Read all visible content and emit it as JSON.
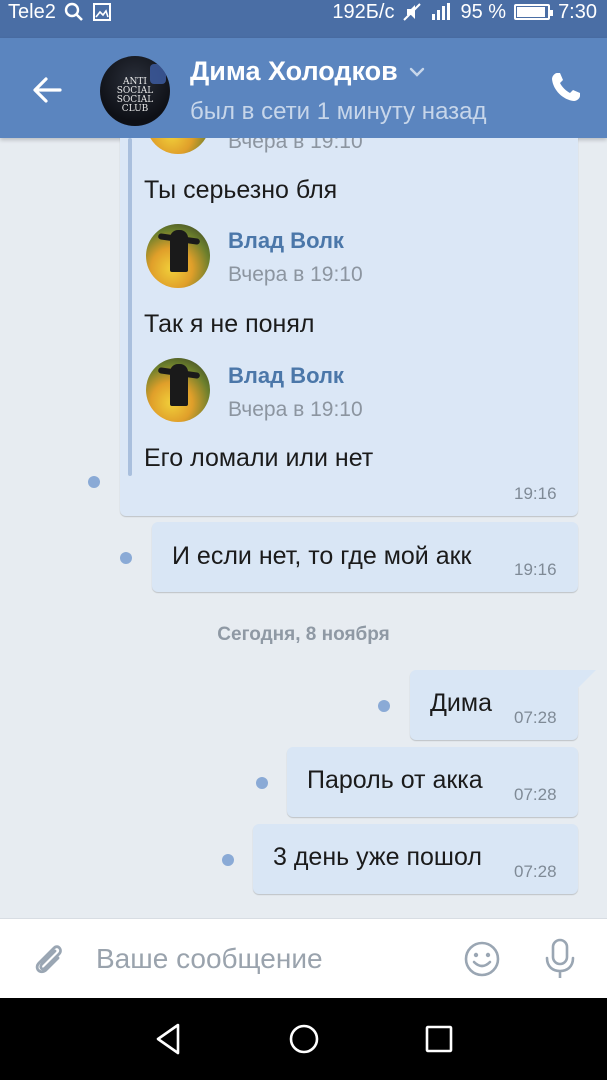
{
  "status_bar": {
    "carrier": "Tele2",
    "speed": "192Б/с",
    "battery": "95 %",
    "battery_level": 0.95,
    "time": "7:30"
  },
  "header": {
    "title": "Дима Холодков",
    "subtitle": "был в сети 1 минуту назад",
    "avatar_text": "ANTI SOCIAL SOCIAL CLUB"
  },
  "forwarded": [
    {
      "name": "Влад Волк",
      "date": "Вчера в 19:10",
      "text": "Ты серьезно бля"
    },
    {
      "name": "Влад Волк",
      "date": "Вчера в 19:10",
      "text": "Так я не понял"
    },
    {
      "name": "Влад Волк",
      "date": "Вчера в 19:10",
      "text": "Его ломали или нет"
    }
  ],
  "forwarded_partial_date": "Вчера в 19:10",
  "forward_bubble_time": "19:16",
  "messages_before": [
    {
      "text": "И если нет, то где мой акк",
      "time": "19:16"
    }
  ],
  "date_separator": "Сегодня, 8 ноября",
  "messages_today": [
    {
      "text": "Дима",
      "time": "07:28"
    },
    {
      "text": "Пароль от акка",
      "time": "07:28"
    },
    {
      "text": "3 день уже пошол",
      "time": "07:28"
    }
  ],
  "input": {
    "placeholder": "Ваше сообщение"
  },
  "colors": {
    "header": "#5b85bf",
    "statusbar": "#4a6ea5",
    "bubble": "#d9e6f5",
    "background": "#e7ecf1",
    "accent": "#4b77a9"
  },
  "icons": [
    "back-arrow-icon",
    "chevron-down-icon",
    "phone-icon",
    "paperclip-icon",
    "smile-icon",
    "microphone-icon",
    "nav-back-icon",
    "nav-home-icon",
    "nav-recents-icon",
    "search-icon",
    "image-icon",
    "mute-icon",
    "signal-icon",
    "battery-icon"
  ]
}
